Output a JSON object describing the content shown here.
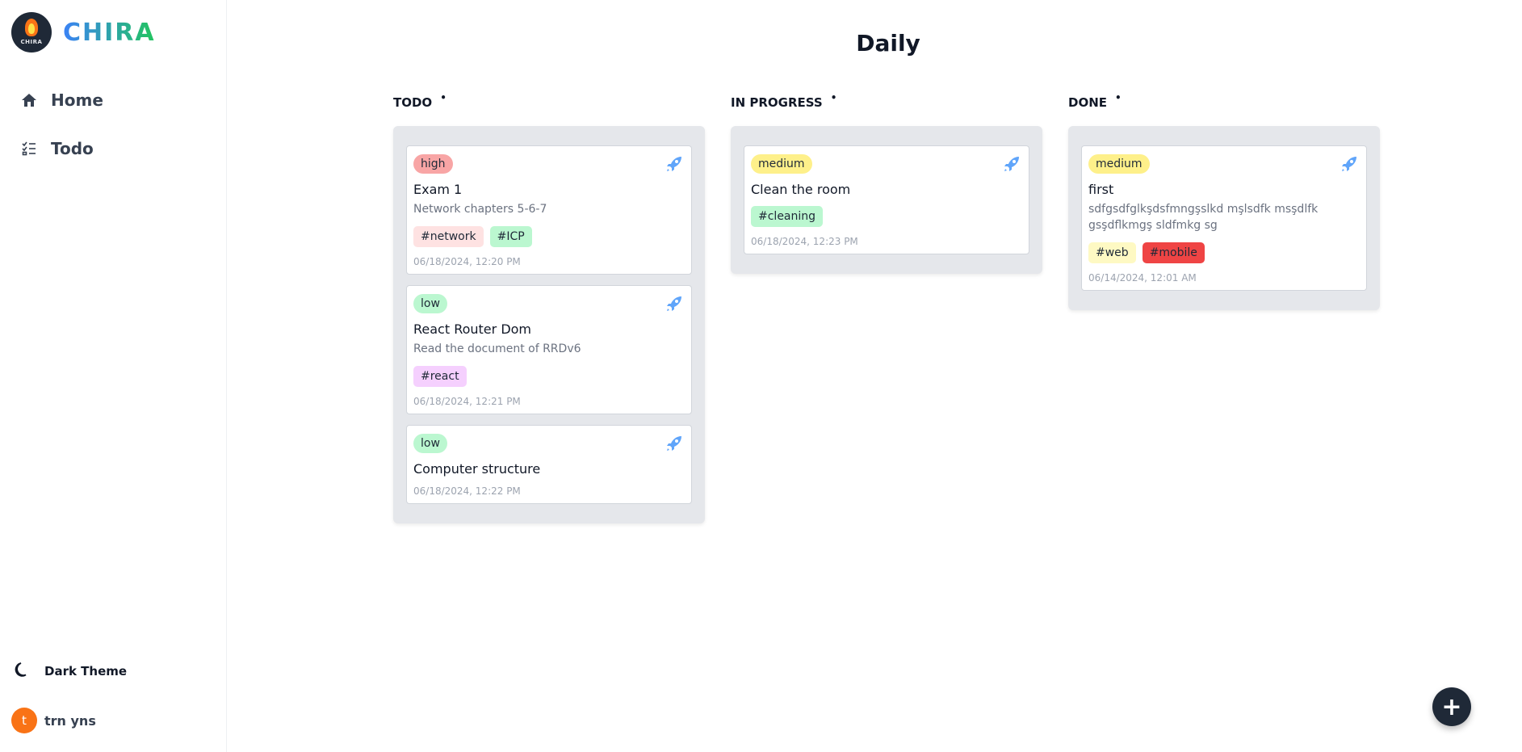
{
  "app": {
    "name": "CHIRA",
    "logo_text": "CHIRA"
  },
  "sidebar": {
    "items": [
      {
        "label": "Home",
        "icon": "home-icon"
      },
      {
        "label": "Todo",
        "icon": "list-check-icon"
      }
    ],
    "theme_label": "Dark Theme",
    "user": {
      "initial": "t",
      "name": "trn yns"
    }
  },
  "page": {
    "title": "Daily"
  },
  "colors": {
    "rocket": "#60a5fa",
    "brand_start": "#3b82f6",
    "brand_end": "#22c55e"
  },
  "columns": [
    {
      "title": "TODO",
      "dot": "•",
      "cards": [
        {
          "priority": "high",
          "title": "Exam 1",
          "desc": "Network chapters 5-6-7",
          "tags": [
            {
              "label": "#network",
              "color": "#fee2e2"
            },
            {
              "label": "#ICP",
              "color": "#bbf7d0"
            }
          ],
          "date": "06/18/2024, 12:20 PM"
        },
        {
          "priority": "low",
          "title": "React Router Dom",
          "desc": "Read the document of RRDv6",
          "tags": [
            {
              "label": "#react",
              "color": "#f5d0fe"
            }
          ],
          "date": "06/18/2024, 12:21 PM"
        },
        {
          "priority": "low",
          "title": "Computer structure",
          "desc": "",
          "tags": [],
          "date": "06/18/2024, 12:22 PM"
        }
      ]
    },
    {
      "title": "IN PROGRESS",
      "dot": "•",
      "cards": [
        {
          "priority": "medium",
          "title": "Clean the room",
          "desc": "",
          "tags": [
            {
              "label": "#cleaning",
              "color": "#bbf7d0"
            }
          ],
          "date": "06/18/2024, 12:23 PM"
        }
      ]
    },
    {
      "title": "DONE",
      "dot": "•",
      "cards": [
        {
          "priority": "medium",
          "title": "first",
          "desc": "sdfgsdfglkşdsfmngşslkd mşlsdfk msşdlfk gsşdflkmgş sldfmkg sg",
          "tags": [
            {
              "label": "#web",
              "color": "#fef9c3"
            },
            {
              "label": "#mobile",
              "color": "#ef4444"
            }
          ],
          "date": "06/14/2024, 12:01 AM"
        }
      ]
    }
  ],
  "fab": {
    "label": "+",
    "icon": "plus-icon"
  }
}
